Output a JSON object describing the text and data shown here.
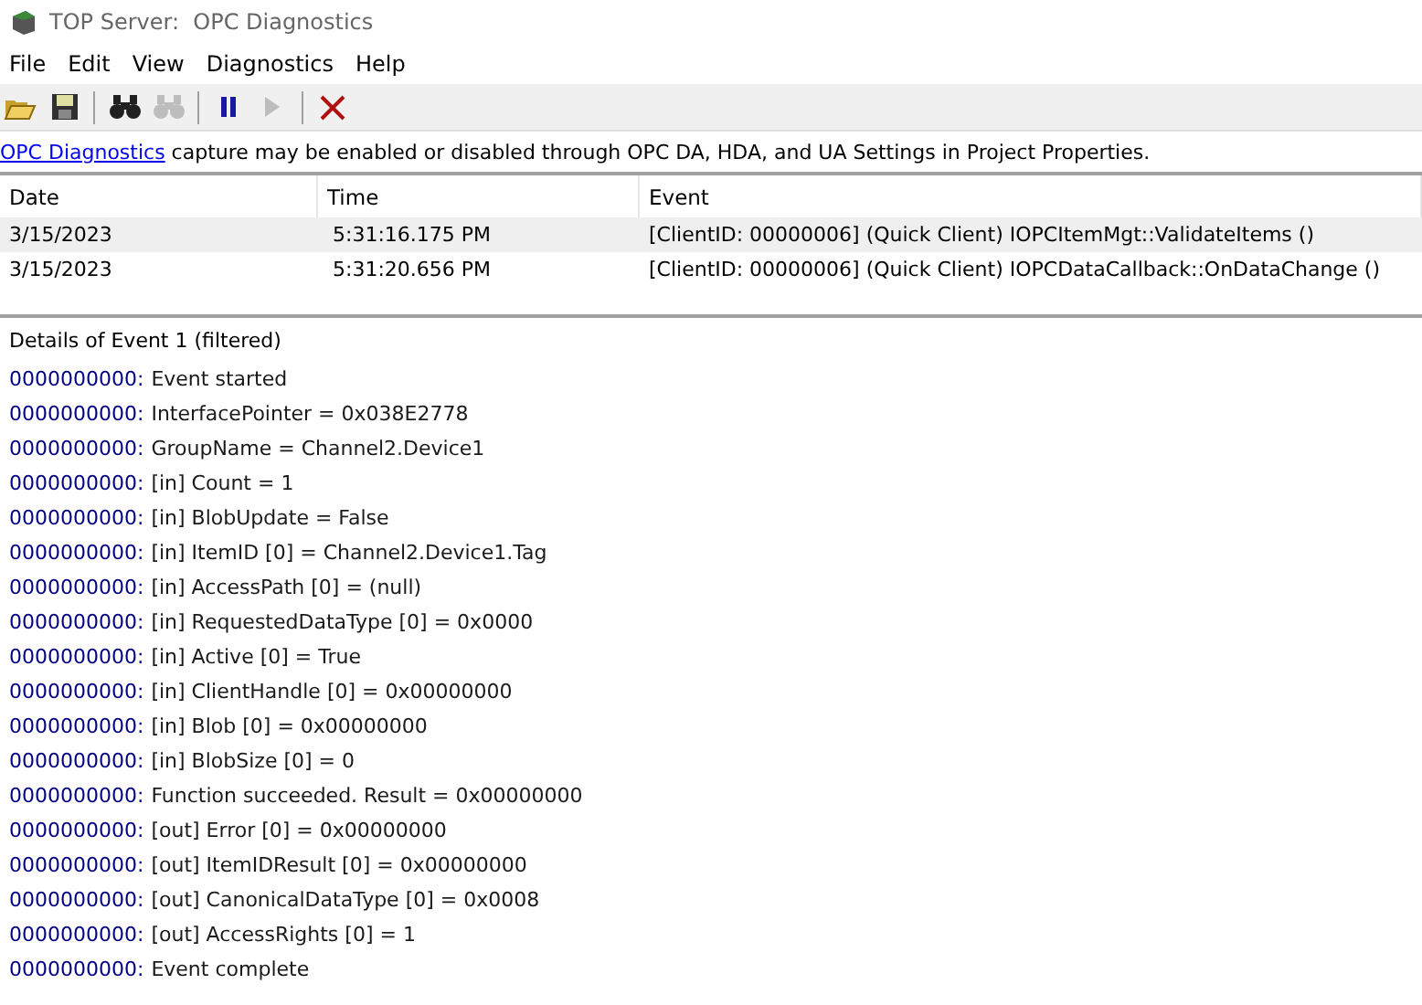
{
  "window": {
    "title": "TOP Server:  OPC Diagnostics"
  },
  "menu": [
    "File",
    "Edit",
    "View",
    "Diagnostics",
    "Help"
  ],
  "toolbar": [
    {
      "kind": "open",
      "disabled": false
    },
    {
      "kind": "save",
      "disabled": false
    },
    {
      "kind": "sep"
    },
    {
      "kind": "find",
      "disabled": false
    },
    {
      "kind": "find-next",
      "disabled": true
    },
    {
      "kind": "sep"
    },
    {
      "kind": "pause",
      "disabled": false
    },
    {
      "kind": "play",
      "disabled": true
    },
    {
      "kind": "sep"
    },
    {
      "kind": "clear",
      "disabled": false
    }
  ],
  "info": {
    "link": "OPC Diagnostics",
    "text": " capture may be enabled or disabled through OPC DA, HDA, and UA Settings in Project Properties."
  },
  "table": {
    "columns": [
      "Date",
      "Time",
      "Event"
    ],
    "rows": [
      {
        "cells": [
          "3/15/2023",
          "5:31:16.175 PM",
          "[ClientID: 00000006] (Quick Client) IOPCItemMgt::ValidateItems ()"
        ],
        "selected": true
      },
      {
        "cells": [
          "3/15/2023",
          "5:31:20.656 PM",
          "[ClientID: 00000006] (Quick Client) IOPCDataCallback::OnDataChange ()"
        ],
        "selected": false
      }
    ]
  },
  "details": {
    "title": "Details of Event 1 (filtered)",
    "lines": [
      {
        "stamp": "0000000000:",
        "text": "Event started"
      },
      {
        "stamp": "0000000000:",
        "text": "InterfacePointer = 0x038E2778"
      },
      {
        "stamp": "0000000000:",
        "text": "GroupName = Channel2.Device1"
      },
      {
        "stamp": "0000000000:",
        "text": "[in] Count = 1"
      },
      {
        "stamp": "0000000000:",
        "text": "[in] BlobUpdate = False"
      },
      {
        "stamp": "0000000000:",
        "text": "[in] ItemID [0] = Channel2.Device1.Tag"
      },
      {
        "stamp": "0000000000:",
        "text": "[in] AccessPath [0] = (null)"
      },
      {
        "stamp": "0000000000:",
        "text": "[in] RequestedDataType [0] = 0x0000"
      },
      {
        "stamp": "0000000000:",
        "text": "[in] Active [0] = True"
      },
      {
        "stamp": "0000000000:",
        "text": "[in] ClientHandle [0] = 0x00000000"
      },
      {
        "stamp": "0000000000:",
        "text": "[in] Blob [0] = 0x00000000"
      },
      {
        "stamp": "0000000000:",
        "text": "[in] BlobSize [0] = 0"
      },
      {
        "stamp": "0000000000:",
        "text": "Function succeeded.  Result = 0x00000000"
      },
      {
        "stamp": "0000000000:",
        "text": "[out] Error [0] = 0x00000000"
      },
      {
        "stamp": "0000000000:",
        "text": "[out] ItemIDResult [0] = 0x00000000"
      },
      {
        "stamp": "0000000000:",
        "text": "[out] CanonicalDataType [0] = 0x0008"
      },
      {
        "stamp": "0000000000:",
        "text": "[out] AccessRights [0] = 1"
      },
      {
        "stamp": "0000000000:",
        "text": "Event complete"
      }
    ]
  }
}
